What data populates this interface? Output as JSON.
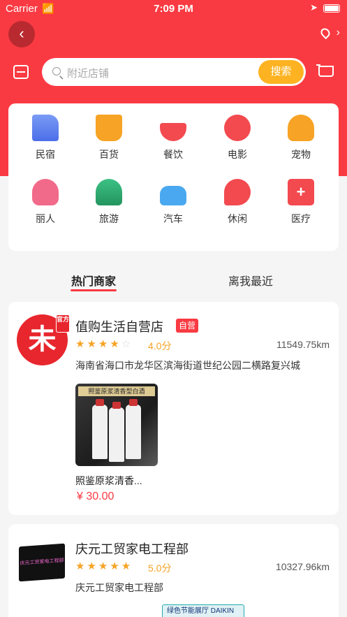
{
  "status_bar": {
    "carrier": "Carrier",
    "time": "7:09 PM"
  },
  "search": {
    "placeholder": "附近店铺",
    "button": "搜索"
  },
  "categories": [
    {
      "label": "民宿",
      "icon": "building-icon",
      "color": "#5a7ff0"
    },
    {
      "label": "百货",
      "icon": "basket-icon",
      "color": "#f7a325"
    },
    {
      "label": "餐饮",
      "icon": "bowl-icon",
      "color": "#f24a4f"
    },
    {
      "label": "电影",
      "icon": "film-reel-icon",
      "color": "#f24a4f"
    },
    {
      "label": "宠物",
      "icon": "dog-icon",
      "color": "#f7a325"
    },
    {
      "label": "丽人",
      "icon": "woman-icon",
      "color": "#f26a8a"
    },
    {
      "label": "旅游",
      "icon": "palm-tree-icon",
      "color": "#34b37a"
    },
    {
      "label": "汽车",
      "icon": "car-icon",
      "color": "#4aa8f0"
    },
    {
      "label": "休闲",
      "icon": "microphone-icon",
      "color": "#f24a4f"
    },
    {
      "label": "医疗",
      "icon": "medical-kit-icon",
      "color": "#f24a4f"
    }
  ],
  "tabs": [
    {
      "label": "热门商家",
      "active": true
    },
    {
      "label": "离我最近",
      "active": false
    }
  ],
  "shops": [
    {
      "name": "值购生活自营店",
      "badge": "自营",
      "logo_text": "未",
      "logo_tag": "官方",
      "rating": 4,
      "score": "4.0分",
      "distance": "11549.75km",
      "address": "海南省海口市龙华区滨海街道世纪公园二横路复兴城",
      "product": {
        "image_text": "照鉴原浆清香型白酒",
        "name": "照鉴原浆清香...",
        "price": "¥ 30.00"
      }
    },
    {
      "name": "庆元工贸家电工程部",
      "badge": "",
      "logo_text": "庆元工贸家电工程部",
      "rating": 5,
      "score": "5.0分",
      "distance": "10327.96km",
      "address": "庆元工贸家电工程部",
      "product": {
        "image_text": "绿色节能展厅 DAIKIN"
      }
    }
  ]
}
